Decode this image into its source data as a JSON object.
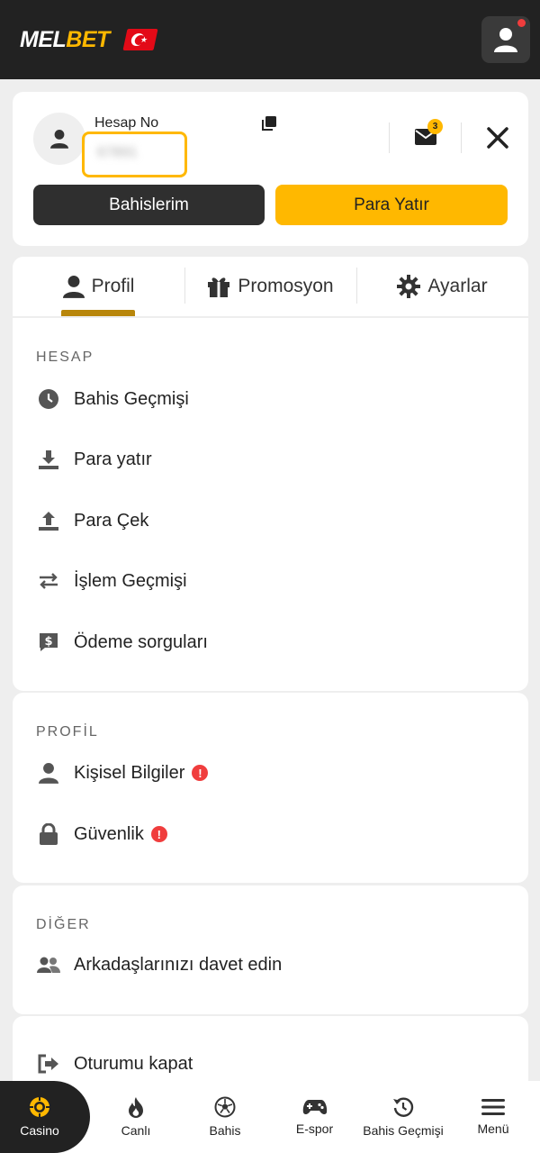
{
  "header": {
    "logo_main": "MEL",
    "logo_accent": "BET",
    "flag_icon": "turkey-flag-icon",
    "user_icon": "user-icon",
    "notification_color": "#f03d3d"
  },
  "account": {
    "label": "Hesap No",
    "number": "67891",
    "message_count": "3",
    "my_bets_button": "Bahislerim",
    "deposit_button": "Para Yatır"
  },
  "tabs": [
    {
      "label": "Profil",
      "icon": "user-icon",
      "active": true
    },
    {
      "label": "Promosyon",
      "icon": "gift-icon",
      "active": false
    },
    {
      "label": "Ayarlar",
      "icon": "gear-icon",
      "active": false
    }
  ],
  "sections": {
    "hesap": {
      "title": "HESAP",
      "items": [
        {
          "label": "Bahis Geçmişi",
          "icon": "clock-icon"
        },
        {
          "label": "Para yatır",
          "icon": "download-icon"
        },
        {
          "label": "Para Çek",
          "icon": "upload-icon"
        },
        {
          "label": "İşlem Geçmişi",
          "icon": "transfer-arrows-icon"
        },
        {
          "label": "Ödeme sorguları",
          "icon": "payment-query-icon"
        }
      ]
    },
    "profil": {
      "title": "PROFİL",
      "items": [
        {
          "label": "Kişisel Bilgiler",
          "icon": "user-icon",
          "warning": "!"
        },
        {
          "label": "Güvenlik",
          "icon": "lock-icon",
          "warning": "!"
        }
      ]
    },
    "diger": {
      "title": "DİĞER",
      "items": [
        {
          "label": "Arkadaşlarınızı davet edin",
          "icon": "users-icon"
        }
      ]
    },
    "logout": {
      "label": "Oturumu kapat",
      "icon": "logout-icon"
    }
  },
  "bottom_nav": [
    {
      "label": "Casino",
      "icon": "casino-chip-icon",
      "active": true
    },
    {
      "label": "Canlı",
      "icon": "flame-icon"
    },
    {
      "label": "Bahis",
      "icon": "soccer-ball-icon"
    },
    {
      "label": "E-spor",
      "icon": "gamepad-icon"
    },
    {
      "label": "Bahis Geçmişi",
      "icon": "history-icon"
    },
    {
      "label": "Menü",
      "icon": "hamburger-menu-icon"
    }
  ],
  "colors": {
    "accent": "#ffb800",
    "header_bg": "#222222",
    "page_bg": "#eeeeee",
    "warning": "#f03d3d",
    "tab_underline": "#b8860b"
  }
}
